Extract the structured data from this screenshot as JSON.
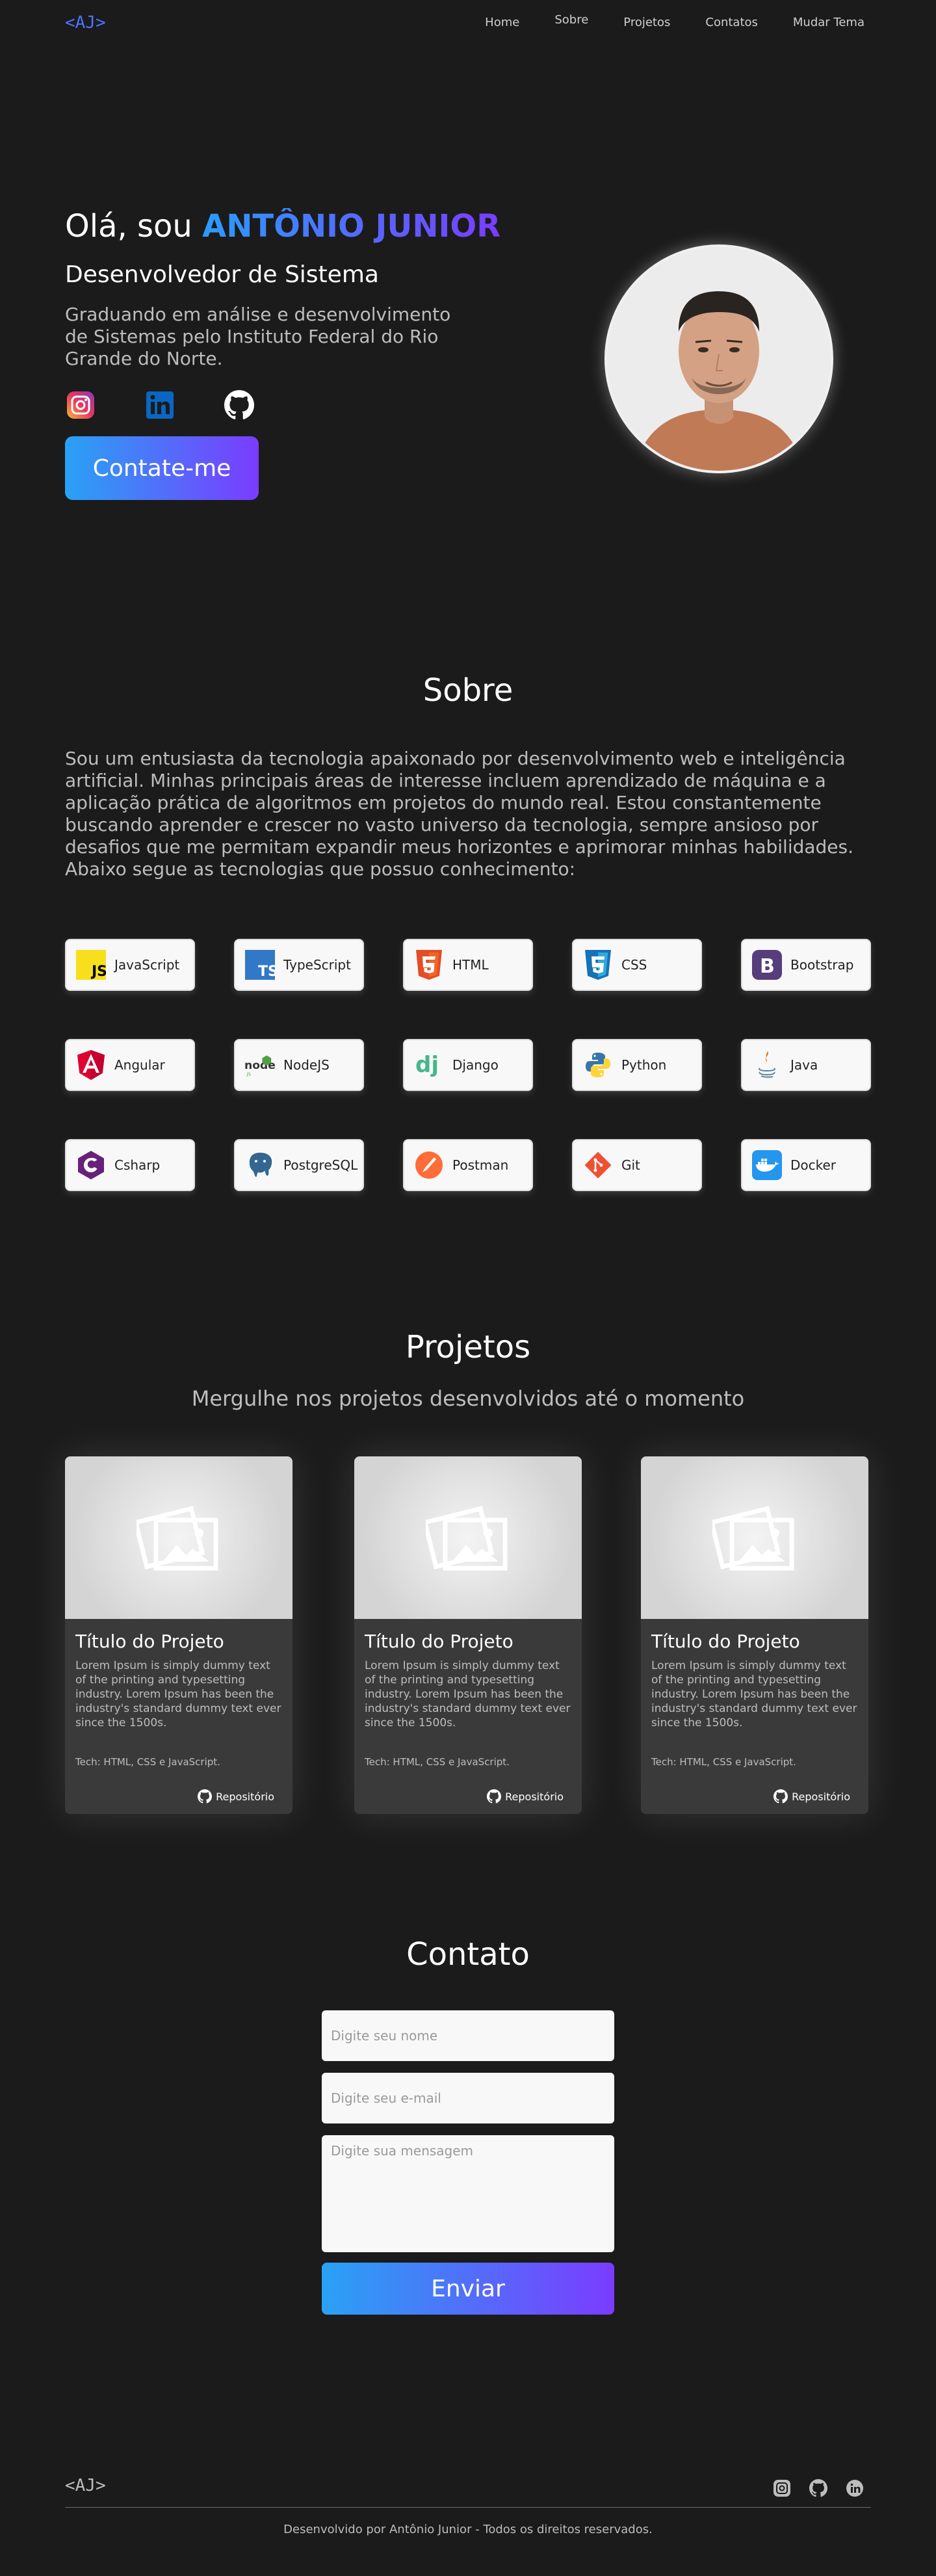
{
  "header": {
    "logo": "<AJ>",
    "nav": [
      "Home",
      "Sobre",
      "Projetos",
      "Contatos",
      "Mudar Tema"
    ]
  },
  "hero": {
    "greeting": "Olá, sou ",
    "name": "ANTÔNIO JUNIOR",
    "role": "Desenvolvedor de Sistema",
    "bio": "Graduando em análise e desenvolvimento de Sistemas pelo Instituto Federal do Rio Grande do Norte.",
    "cta": "Contate-me",
    "socials": [
      "instagram-icon",
      "linkedin-icon",
      "github-icon"
    ]
  },
  "about": {
    "title": "Sobre",
    "text": "Sou um entusiasta da tecnologia apaixonado por desenvolvimento web e inteligência artificial. Minhas principais áreas de interesse incluem aprendizado de máquina e a aplicação prática de algoritmos em projetos do mundo real. Estou constantemente buscando aprender e crescer no vasto universo da tecnologia, sempre ansioso por desafios que me permitam expandir meus horizontes e aprimorar minhas habilidades. Abaixo segue as tecnologias que possuo conhecimento:",
    "techs": [
      "JavaScript",
      "TypeScript",
      "HTML",
      "CSS",
      "Bootstrap",
      "Angular",
      "NodeJS",
      "Django",
      "Python",
      "Java",
      "Csharp",
      "PostgreSQL",
      "Postman",
      "Git",
      "Docker"
    ]
  },
  "projects": {
    "title": "Projetos",
    "subtitle": "Mergulhe nos projetos desenvolvidos até o momento",
    "cards": [
      {
        "title": "Título do Projeto",
        "desc": "Lorem Ipsum is simply dummy text of the printing and typesetting industry. Lorem Ipsum has been the industry's standard dummy text ever since the 1500s.",
        "tech": "Tech: HTML, CSS e JavaScript.",
        "repo": "Repositório"
      },
      {
        "title": "Título do Projeto",
        "desc": "Lorem Ipsum is simply dummy text of the printing and typesetting industry. Lorem Ipsum has been the industry's standard dummy text ever since the 1500s.",
        "tech": "Tech: HTML, CSS e JavaScript.",
        "repo": "Repositório"
      },
      {
        "title": "Título do Projeto",
        "desc": "Lorem Ipsum is simply dummy text of the printing and typesetting industry. Lorem Ipsum has been the industry's standard dummy text ever since the 1500s.",
        "tech": "Tech: HTML, CSS e JavaScript.",
        "repo": "Repositório"
      }
    ]
  },
  "contact": {
    "title": "Contato",
    "name_placeholder": "Digite seu nome",
    "email_placeholder": "Digite seu e-mail",
    "message_placeholder": "Digite sua mensagem",
    "send": "Enviar"
  },
  "footer": {
    "logo": "<AJ>",
    "text": "Desenvolvido por Antônio Junior - Todos os direitos reservados."
  },
  "colors": {
    "background": "#1b1b1b",
    "accent_start": "#29a2f5",
    "accent_end": "#7a3cff"
  }
}
